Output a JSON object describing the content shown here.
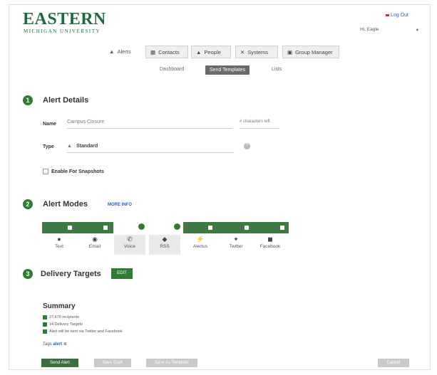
{
  "header": {
    "logo_main": "EASTERN",
    "logo_sub": "MICHIGAN UNIVERSITY",
    "logout": "Log Out",
    "user_select": "Hi, Eagle",
    "user_select_chevron": "▾"
  },
  "nav": {
    "home": "Alerts",
    "buttons": [
      {
        "label": "Contacts",
        "icon": "contacts-icon"
      },
      {
        "label": "People",
        "icon": "people-icon"
      },
      {
        "label": "Systems",
        "icon": "tools-icon"
      },
      {
        "label": "Group Manager",
        "icon": "group-icon"
      }
    ]
  },
  "subnav": {
    "dashboard": "Dashboard",
    "send": "Send Templates",
    "lists": "Lists"
  },
  "step1": {
    "number": "1",
    "title": "Alert Details",
    "name_label": "Name",
    "name_value": "Campus Closure",
    "name_hint": "# characters left",
    "type_label": "Type",
    "type_value": "Standard",
    "type_help": "?",
    "checkbox_label": "Enable For Snapshots"
  },
  "step2": {
    "number": "2",
    "title": "Alert Modes",
    "more_info": "MORE INFO",
    "modes": [
      {
        "label": "Text",
        "icon": "●"
      },
      {
        "label": "Email",
        "icon": "◉"
      },
      {
        "label": "Voice",
        "icon": "✆"
      },
      {
        "label": "RSS",
        "icon": "◆"
      },
      {
        "label": "Alertus",
        "icon": "⚡"
      },
      {
        "label": "Twitter",
        "icon": "✦"
      },
      {
        "label": "Facebook",
        "icon": "◼"
      }
    ]
  },
  "step3": {
    "number": "3",
    "title": "Delivery Targets",
    "edit": "EDIT"
  },
  "summary": {
    "title": "Summary",
    "lines": [
      "27,670 recipients",
      "14 Delivery Targets",
      "Alert will be sent via Twitter and Facebook"
    ],
    "tags_label": "Tags",
    "tag": "alert",
    "tag_edit": "⊕"
  },
  "footer": {
    "primary": "Send Alert",
    "secondary1": "Save Draft",
    "secondary2": "Save As Template",
    "right": "Cancel"
  },
  "colors": {
    "brand": "#1f6a3e",
    "step": "#2e7d32",
    "modes_bar": "#3f7a42"
  }
}
